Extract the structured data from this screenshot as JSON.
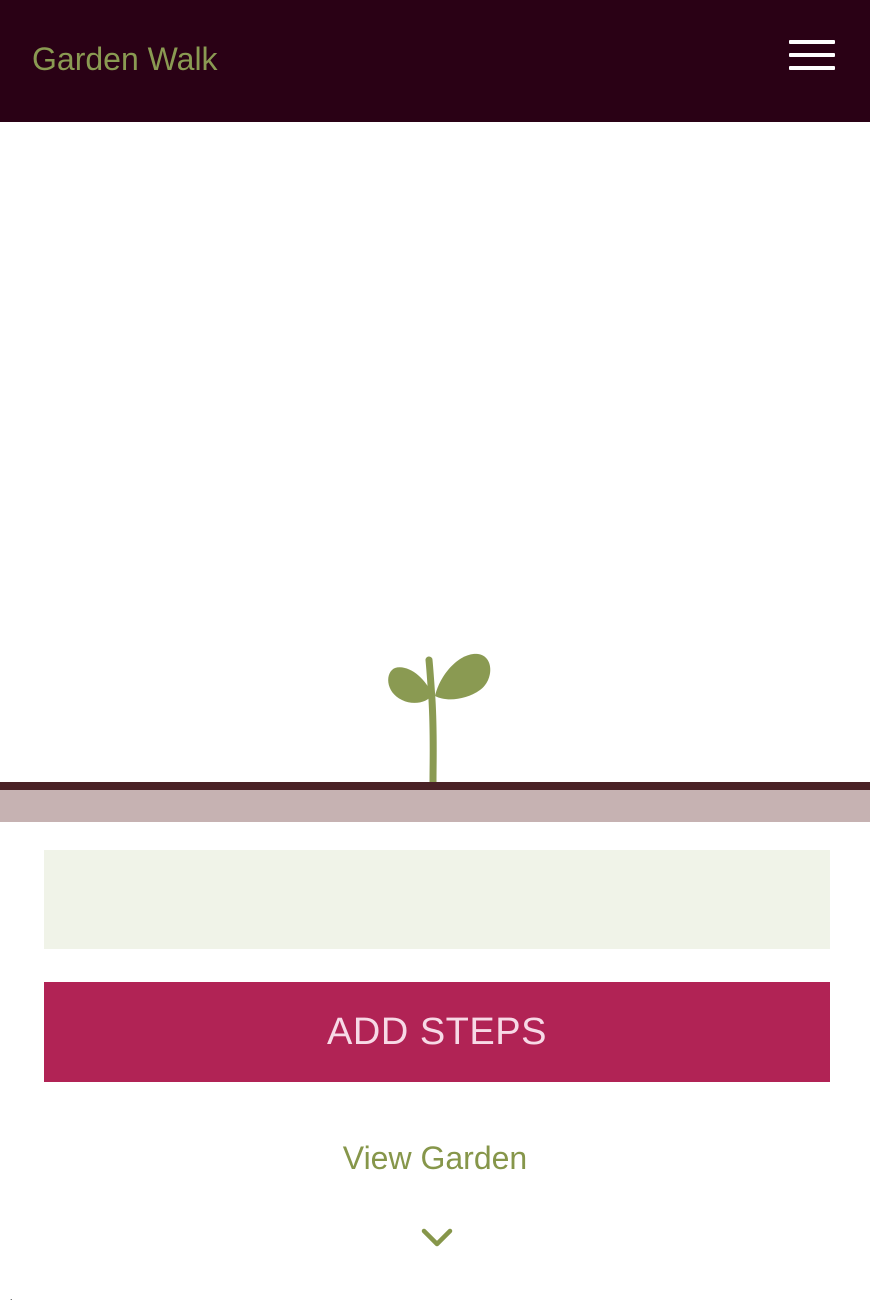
{
  "header": {
    "title": "Garden Walk",
    "menu_icon": "hamburger-menu-icon"
  },
  "garden": {
    "plant_icon": "sprout-icon"
  },
  "steps_input": {
    "value": "",
    "placeholder": ""
  },
  "actions": {
    "add_steps_label": "ADD STEPS",
    "view_garden_label": "View Garden",
    "scroll_icon": "chevron-down-icon"
  },
  "colors": {
    "header_bg": "#2a0115",
    "brand_green": "#8a9a52",
    "button_bg": "#b12355",
    "button_text": "#f7d9e6",
    "soil_line": "#4a2226",
    "soil_band": "#c6b2b2",
    "field_bg": "#f0f3e8"
  }
}
